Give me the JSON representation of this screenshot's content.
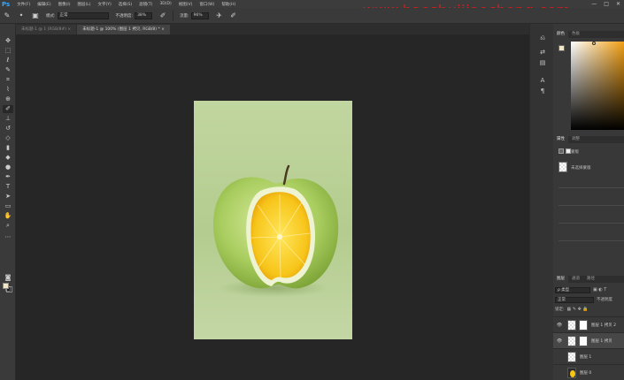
{
  "app": {
    "logo": "Ps",
    "menu": [
      "文件(F)",
      "编辑(E)",
      "图像(I)",
      "图层(L)",
      "文字(Y)",
      "选择(S)",
      "滤镜(T)",
      "3D(D)",
      "视图(V)",
      "窗口(W)",
      "帮助(H)"
    ],
    "window_controls": [
      "—",
      "□",
      "✕"
    ]
  },
  "watermark": "www.haoshuijiaocheng.com",
  "options_bar": {
    "mode_label": "模式:",
    "mode_value": "正常",
    "opacity_label": "不透明度:",
    "opacity_value": "38%",
    "flow_label": "流量:",
    "flow_value": "96%"
  },
  "tabs": [
    {
      "label": "未标题-1 @ 1 (RGB/8#) ×",
      "active": false
    },
    {
      "label": "未标题-1 @ 100% (图层 1 拷贝, RGB/8) * ×",
      "active": true
    }
  ],
  "panels": {
    "color_tabs": [
      "颜色",
      "色板"
    ],
    "properties_tabs": [
      "属性",
      "调整"
    ],
    "properties_title": "蒙版",
    "properties_subtitle": "未选择蒙版",
    "layers_tabs": [
      "图层",
      "通道",
      "路径"
    ],
    "layers_kind": "ρ 类型",
    "blend_mode": "正常",
    "opacity_label": "不透明度",
    "lock_label": "锁定:",
    "layers": [
      {
        "name": "图层 1 拷贝 2",
        "visible": true,
        "selected": false,
        "mask": true
      },
      {
        "name": "图层 1 拷贝",
        "visible": true,
        "selected": true,
        "mask": true
      },
      {
        "name": "图层 1",
        "visible": false,
        "selected": false,
        "mask": false
      },
      {
        "name": "图层 0",
        "visible": false,
        "selected": false,
        "mask": false,
        "lemon": true
      }
    ]
  },
  "colors": {
    "foreground": "#f2e6c8",
    "background": "#1c1c1c",
    "accent": "#31a8ff",
    "watermark": "#d81b1b"
  }
}
